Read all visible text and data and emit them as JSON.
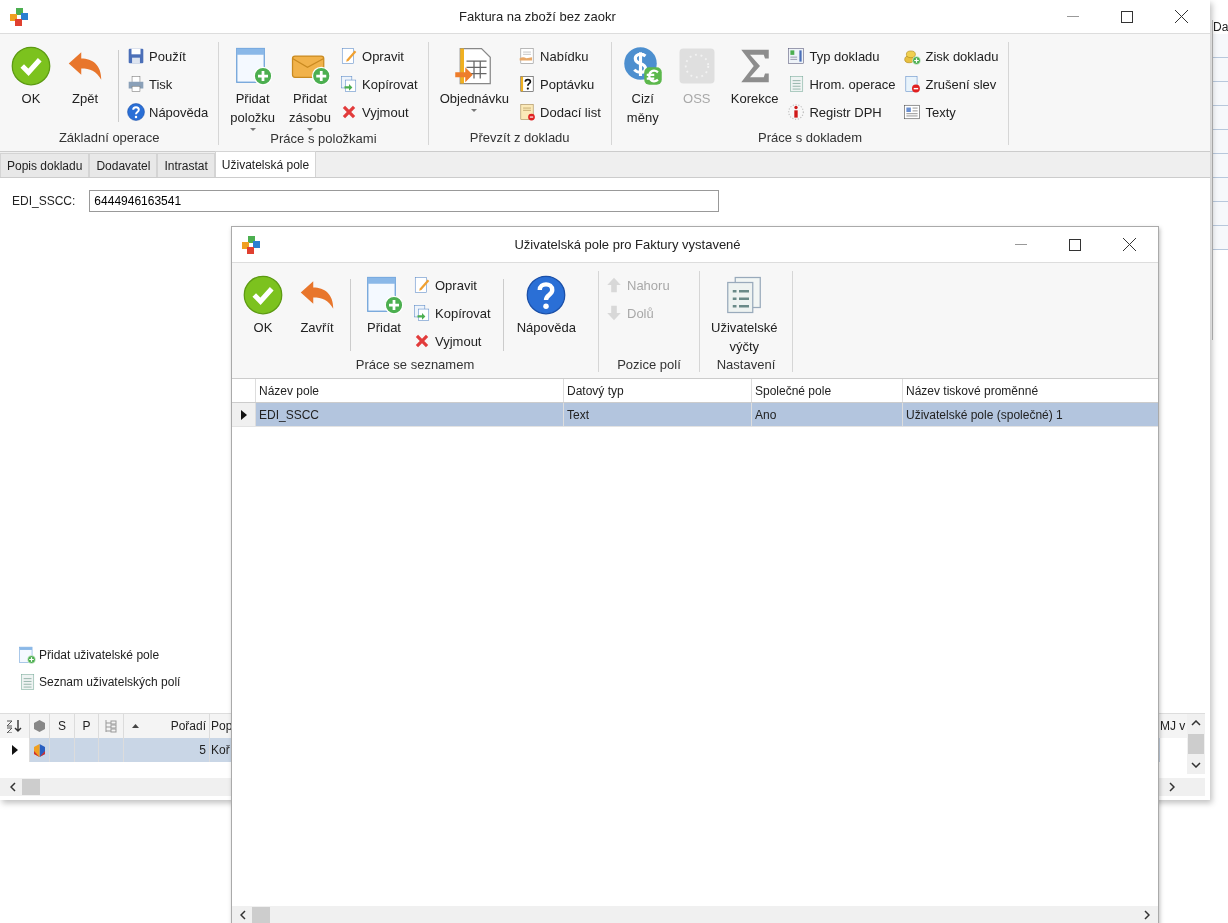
{
  "background_window": {
    "column_header": "Da"
  },
  "main_window": {
    "title": "Faktura na zboží bez zaokr",
    "ribbon": [
      {
        "label": "Základní operace",
        "items": [
          {
            "kind": "large",
            "label": "OK",
            "disabled": false,
            "dropdown": false
          },
          {
            "kind": "large",
            "label": "Zpět",
            "disabled": false,
            "dropdown": false
          },
          {
            "kind": "separator"
          },
          {
            "kind": "stack",
            "buttons": [
              {
                "label": "Použít",
                "disabled": false
              },
              {
                "label": "Tisk",
                "disabled": false
              },
              {
                "label": "Nápověda",
                "disabled": false
              }
            ]
          }
        ]
      },
      {
        "label": "Práce s položkami",
        "items": [
          {
            "kind": "large",
            "label": "Přidat\npoložku",
            "disabled": false,
            "dropdown": true
          },
          {
            "kind": "large",
            "label": "Přidat\nzásobu",
            "disabled": false,
            "dropdown": true
          },
          {
            "kind": "stack",
            "buttons": [
              {
                "label": "Opravit",
                "disabled": false
              },
              {
                "label": "Kopírovat",
                "disabled": false
              },
              {
                "label": "Vyjmout",
                "disabled": false
              }
            ]
          }
        ]
      },
      {
        "label": "Převzít z dokladu",
        "items": [
          {
            "kind": "large",
            "label": "Objednávku",
            "disabled": false,
            "dropdown": true
          },
          {
            "kind": "stack",
            "buttons": [
              {
                "label": "Nabídku",
                "disabled": false
              },
              {
                "label": "Poptávku",
                "disabled": false
              },
              {
                "label": "Dodací list",
                "disabled": false
              }
            ]
          }
        ]
      },
      {
        "label": "Práce s dokladem",
        "items": [
          {
            "kind": "large",
            "label": "Cizí\nměny",
            "disabled": false,
            "dropdown": false
          },
          {
            "kind": "large",
            "label": "OSS",
            "disabled": true,
            "dropdown": false
          },
          {
            "kind": "large",
            "label": "Korekce",
            "disabled": false,
            "dropdown": false
          },
          {
            "kind": "stack",
            "buttons": [
              {
                "label": "Typ dokladu",
                "disabled": false
              },
              {
                "label": "Hrom. operace",
                "disabled": false
              },
              {
                "label": "Registr DPH",
                "disabled": false
              }
            ]
          },
          {
            "kind": "stack",
            "buttons": [
              {
                "label": "Zisk dokladu",
                "disabled": false
              },
              {
                "label": "Zrušení slev",
                "disabled": false
              },
              {
                "label": "Texty",
                "disabled": false
              }
            ]
          }
        ]
      }
    ],
    "tabs": [
      {
        "label": "Popis dokladu",
        "selected": false
      },
      {
        "label": "Dodavatel",
        "selected": false
      },
      {
        "label": "Intrastat",
        "selected": false
      },
      {
        "label": "Uživatelská pole",
        "selected": true
      }
    ],
    "field": {
      "label": "EDI_SSCC:",
      "value": "6444946163541"
    },
    "links": [
      "Přidat uživatelské pole",
      "Seznam uživatelských polí"
    ],
    "grid": {
      "columns": [
        "S",
        "P",
        "Pořadí",
        "Pop"
      ],
      "right_column": "MJ v",
      "rows": [
        {
          "selected": true,
          "cells": [
            "",
            "",
            "5",
            "Koř"
          ]
        }
      ]
    }
  },
  "dialog": {
    "title": "Uživatelská pole pro Faktury vystavené",
    "ribbon": [
      {
        "label": "Práce se seznamem",
        "items": [
          {
            "kind": "large",
            "label": "OK",
            "disabled": false,
            "dropdown": false
          },
          {
            "kind": "large",
            "label": "Zavřít",
            "disabled": false,
            "dropdown": false
          },
          {
            "kind": "separator"
          },
          {
            "kind": "large",
            "label": "Přidat",
            "disabled": false,
            "dropdown": false
          },
          {
            "kind": "stack",
            "buttons": [
              {
                "label": "Opravit",
                "disabled": false
              },
              {
                "label": "Kopírovat",
                "disabled": false
              },
              {
                "label": "Vyjmout",
                "disabled": false
              }
            ]
          },
          {
            "kind": "separator"
          },
          {
            "kind": "large",
            "label": "Nápověda",
            "disabled": false,
            "dropdown": false
          }
        ]
      },
      {
        "label": "Pozice polí",
        "items": [
          {
            "kind": "stack",
            "buttons": [
              {
                "label": "Nahoru",
                "disabled": true
              },
              {
                "label": "Dolů",
                "disabled": true
              }
            ]
          }
        ]
      },
      {
        "label": "Nastavení",
        "items": [
          {
            "kind": "large",
            "label": "Uživatelské\nvýčty",
            "disabled": false,
            "dropdown": false
          }
        ]
      }
    ],
    "grid": {
      "columns": [
        "Název pole",
        "Datový typ",
        "Společné pole",
        "Název tiskové proměnné"
      ],
      "rows": [
        {
          "selected": true,
          "cells": [
            "EDI_SSCC",
            "Text",
            "Ano",
            "Uživatelské pole (společné) 1"
          ]
        }
      ]
    }
  }
}
